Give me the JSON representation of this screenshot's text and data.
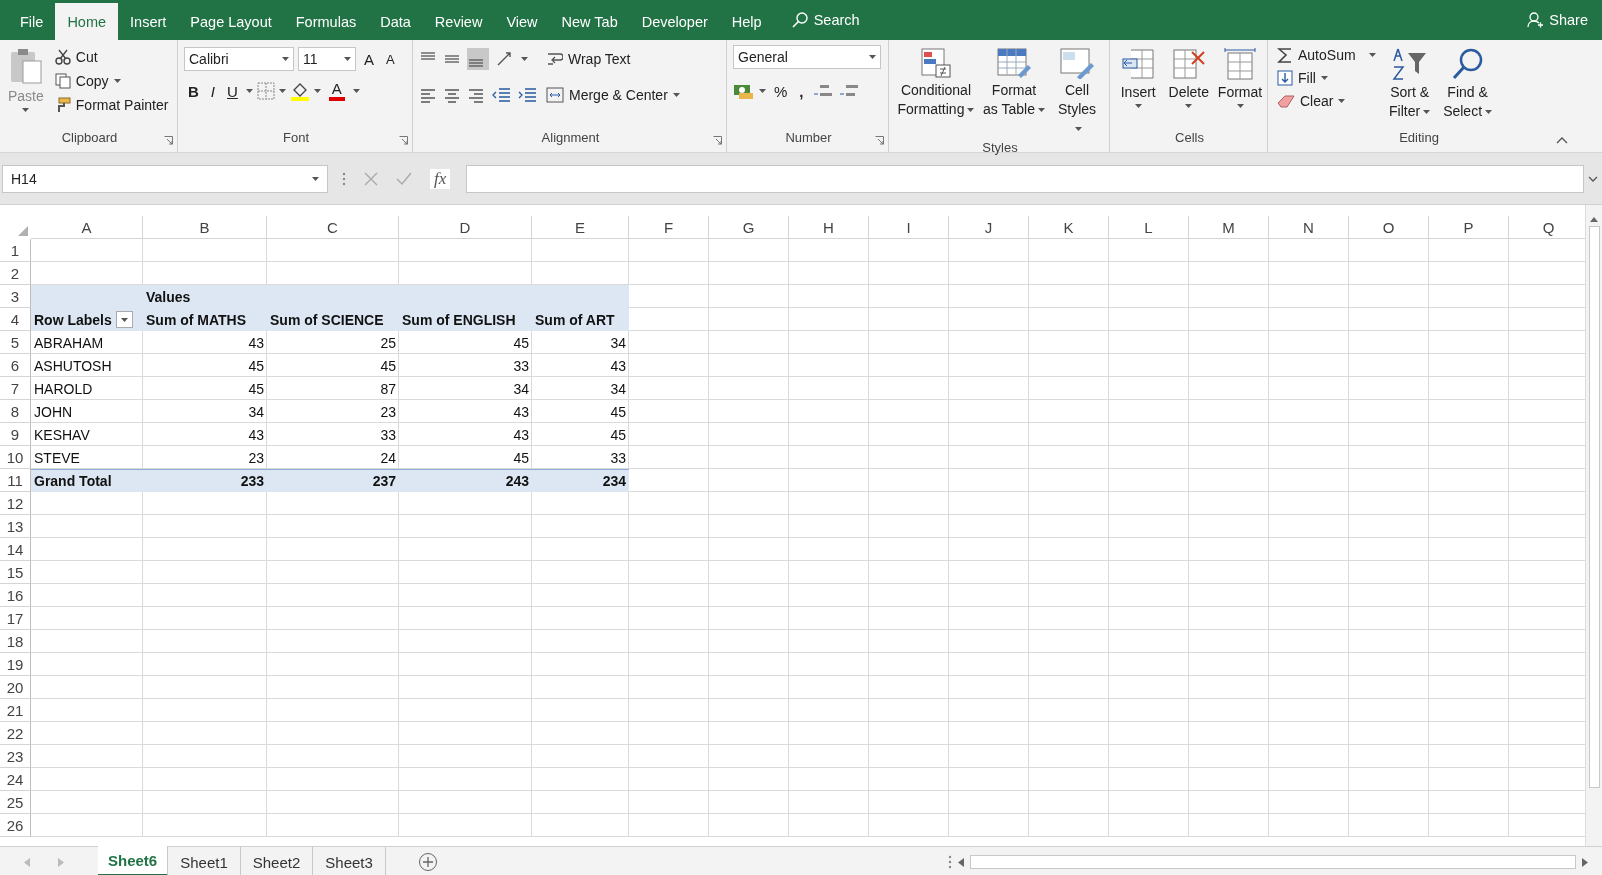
{
  "menu_tabs": [
    {
      "label": "File",
      "selected": false
    },
    {
      "label": "Home",
      "selected": true
    },
    {
      "label": "Insert",
      "selected": false
    },
    {
      "label": "Page Layout",
      "selected": false
    },
    {
      "label": "Formulas",
      "selected": false
    },
    {
      "label": "Data",
      "selected": false
    },
    {
      "label": "Review",
      "selected": false
    },
    {
      "label": "View",
      "selected": false
    },
    {
      "label": "New Tab",
      "selected": false
    },
    {
      "label": "Developer",
      "selected": false
    },
    {
      "label": "Help",
      "selected": false
    }
  ],
  "search": {
    "label": "Search"
  },
  "share": {
    "label": "Share"
  },
  "ribbon": {
    "groups": [
      {
        "kind": "clipboard",
        "label": "Clipboard",
        "launcher": true,
        "paste": {
          "label": "Paste",
          "disabled": true
        },
        "buttons": [
          "Cut",
          "Copy",
          "Format Painter"
        ]
      },
      {
        "kind": "font",
        "label": "Font",
        "launcher": true,
        "font_name": "Calibri",
        "font_size": "11",
        "grow": "A",
        "shrink": "A",
        "styles": [
          "B",
          "I",
          "U"
        ],
        "font_color": "A"
      },
      {
        "kind": "alignment",
        "label": "Alignment",
        "launcher": true,
        "wrap": "Wrap Text",
        "merge": "Merge & Center"
      },
      {
        "kind": "number",
        "label": "Number",
        "launcher": true,
        "format": "General",
        "percent": "%",
        "comma": ","
      },
      {
        "kind": "styles",
        "label": "Styles",
        "launcher": false,
        "buttons": [
          "Conditional Formatting",
          "Format as Table",
          "Cell Styles"
        ]
      },
      {
        "kind": "cells",
        "label": "Cells",
        "launcher": false,
        "buttons": [
          "Insert",
          "Delete",
          "Format"
        ]
      },
      {
        "kind": "editing",
        "label": "Editing",
        "launcher": false,
        "small": [
          "AutoSum",
          "Fill",
          "Clear"
        ],
        "large": [
          "Sort & Filter",
          "Find & Select"
        ]
      }
    ]
  },
  "formula_bar": {
    "name_box": "H14",
    "fx": "fx"
  },
  "columns": [
    "A",
    "B",
    "C",
    "D",
    "E",
    "F",
    "G",
    "H",
    "I",
    "J",
    "K",
    "L",
    "M",
    "N",
    "O",
    "P",
    "Q"
  ],
  "rows": [
    {
      "number": "1",
      "kind": "empty"
    },
    {
      "number": "2",
      "kind": "empty"
    },
    {
      "number": "3",
      "kind": "caption",
      "cells": [
        "Values"
      ]
    },
    {
      "number": "4",
      "kind": "header",
      "cells": [
        "Row Labels",
        "Sum of MATHS",
        "Sum of SCIENCE",
        "Sum of ENGLISH",
        "Sum of ART"
      ]
    },
    {
      "number": "5",
      "kind": "data",
      "cells": [
        "ABRAHAM",
        "43",
        "25",
        "45",
        "34"
      ]
    },
    {
      "number": "6",
      "kind": "data",
      "cells": [
        "ASHUTOSH",
        "45",
        "45",
        "33",
        "43"
      ]
    },
    {
      "number": "7",
      "kind": "data",
      "cells": [
        "HAROLD",
        "45",
        "87",
        "34",
        "34"
      ]
    },
    {
      "number": "8",
      "kind": "data",
      "cells": [
        "JOHN",
        "34",
        "23",
        "43",
        "45"
      ]
    },
    {
      "number": "9",
      "kind": "data",
      "cells": [
        "KESHAV",
        "43",
        "33",
        "43",
        "45"
      ]
    },
    {
      "number": "10",
      "kind": "data",
      "cells": [
        "STEVE",
        "23",
        "24",
        "45",
        "33"
      ]
    },
    {
      "number": "11",
      "kind": "total",
      "cells": [
        "Grand Total",
        "233",
        "237",
        "243",
        "234"
      ]
    },
    {
      "number": "12",
      "kind": "empty"
    },
    {
      "number": "13",
      "kind": "empty"
    },
    {
      "number": "14",
      "kind": "empty"
    },
    {
      "number": "15",
      "kind": "empty"
    },
    {
      "number": "16",
      "kind": "empty"
    },
    {
      "number": "17",
      "kind": "empty"
    },
    {
      "number": "18",
      "kind": "empty"
    },
    {
      "number": "19",
      "kind": "empty"
    },
    {
      "number": "20",
      "kind": "empty"
    },
    {
      "number": "21",
      "kind": "empty"
    },
    {
      "number": "22",
      "kind": "empty"
    },
    {
      "number": "23",
      "kind": "empty"
    },
    {
      "number": "24",
      "kind": "empty"
    },
    {
      "number": "25",
      "kind": "empty"
    },
    {
      "number": "26",
      "kind": "empty"
    }
  ],
  "sheet_tabs": [
    {
      "label": "Sheet6",
      "selected": true
    },
    {
      "label": "Sheet1",
      "selected": false
    },
    {
      "label": "Sheet2",
      "selected": false
    },
    {
      "label": "Sheet3",
      "selected": false
    }
  ]
}
